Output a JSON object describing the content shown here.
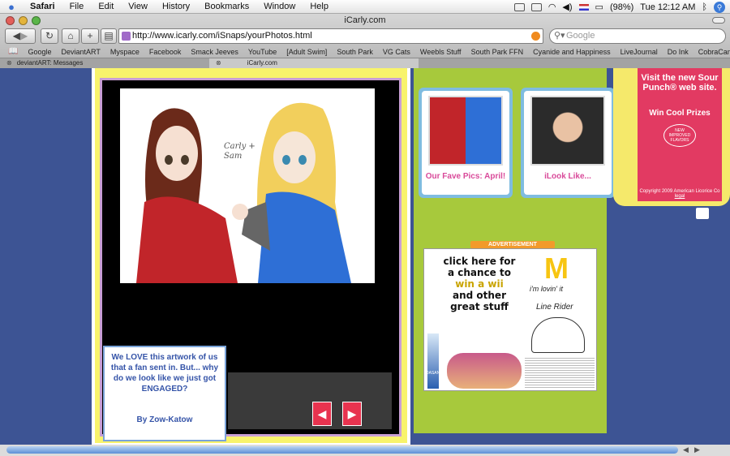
{
  "menubar": {
    "app": "Safari",
    "items": [
      "File",
      "Edit",
      "View",
      "History",
      "Bookmarks",
      "Window",
      "Help"
    ],
    "battery": "(98%)",
    "clock": "Tue 12:12 AM"
  },
  "window": {
    "title": "iCarly.com",
    "url": "http://www.icarly.com/iSnaps/yourPhotos.html",
    "search_placeholder": "Google"
  },
  "bookmarks": [
    "Google",
    "DeviantART",
    "Myspace",
    "Facebook",
    "Smack Jeeves",
    "YouTube",
    "[Adult Swim]",
    "South Park",
    "VG Cats",
    "Weebls Stuff",
    "South Park FFN",
    "Cyanide and Happiness",
    "LiveJournal",
    "Do Ink",
    "CobraCam.TV"
  ],
  "tabs": [
    {
      "label": "deviantART: Messages"
    },
    {
      "label": "iCarly.com"
    }
  ],
  "photo": {
    "handwriting": "Carly + Sam"
  },
  "caption": {
    "text": "We LOVE this artwork of us that a fan sent in. But... why do we look like we just got ENGAGED?",
    "author": "By Zow-Katow"
  },
  "nav": {
    "prev": "◀",
    "next": "▶"
  },
  "thumbs": [
    {
      "label": "Our Fave Pics: April!"
    },
    {
      "label": "iLook Like..."
    }
  ],
  "ad": {
    "tag": "ADVERTISEMENT",
    "headline_1": "click here for",
    "headline_2": "a chance to",
    "headline_3": "win a wii",
    "headline_4": "and other",
    "headline_5": "great stuff",
    "brand_tagline": "i'm lovin' it",
    "game": "Line Rider",
    "bottle": "DASANI"
  },
  "sour_ad": {
    "headline": "Visit the new Sour Punch® web site.",
    "win": "Win Cool Prizes",
    "badge": "NEW IMPROVED FLAVORS",
    "copyright": "Copyright 2009 American Licorice Co",
    "legal": "legal"
  }
}
